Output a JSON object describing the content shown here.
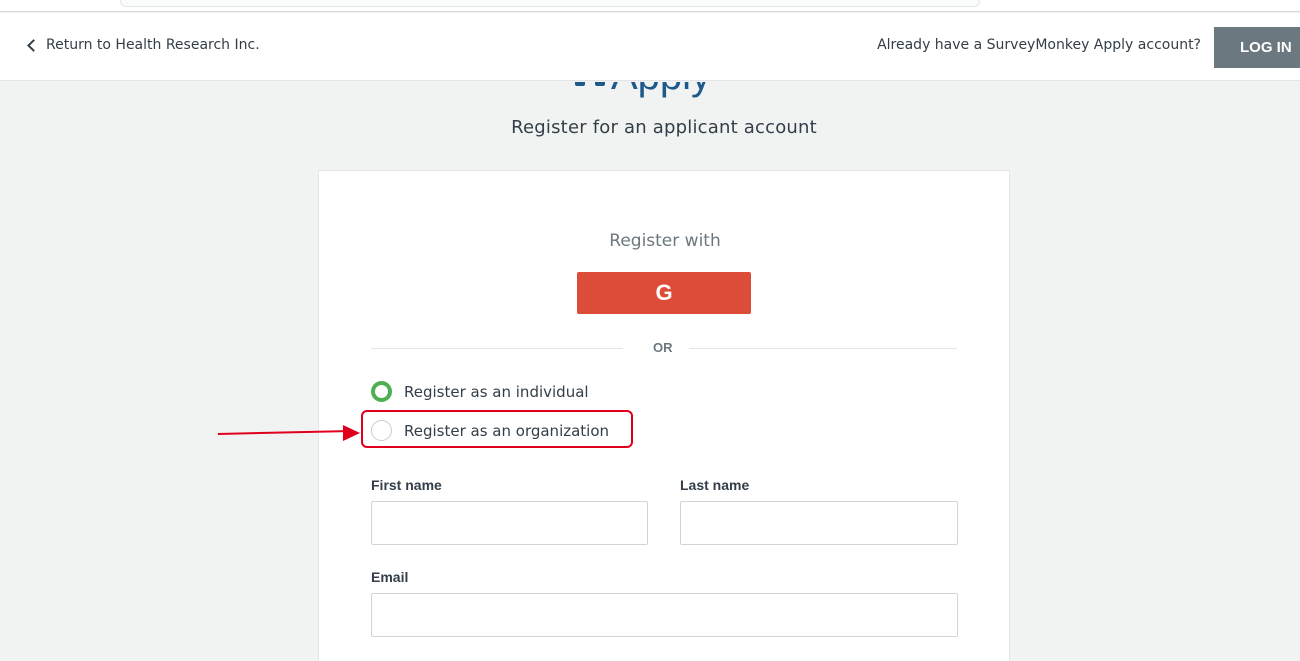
{
  "header": {
    "back_link": "Return to Health Research Inc.",
    "already_text": "Already have a SurveyMonkey Apply account?",
    "login_label": "LOG IN"
  },
  "logo": {
    "text": "Apply"
  },
  "page": {
    "subtitle": "Register for an applicant account"
  },
  "card": {
    "register_with": "Register with",
    "google_label": "G",
    "or_text": "OR",
    "radio_individual": "Register as an individual",
    "radio_organization": "Register as an organization",
    "selected": "individual",
    "first_name_label": "First name",
    "last_name_label": "Last name",
    "email_label": "Email",
    "first_name_value": "",
    "last_name_value": "",
    "email_value": ""
  },
  "colors": {
    "google": "#dd4b39",
    "login_button": "#6b787f",
    "radio_selected": "#4caf50",
    "annotation": "#e0001b",
    "brand": "#1d5a8a"
  },
  "icons": [
    "chevron-left-icon",
    "google-icon",
    "radio-selected-icon",
    "radio-unselected-icon",
    "annotation-arrow"
  ]
}
